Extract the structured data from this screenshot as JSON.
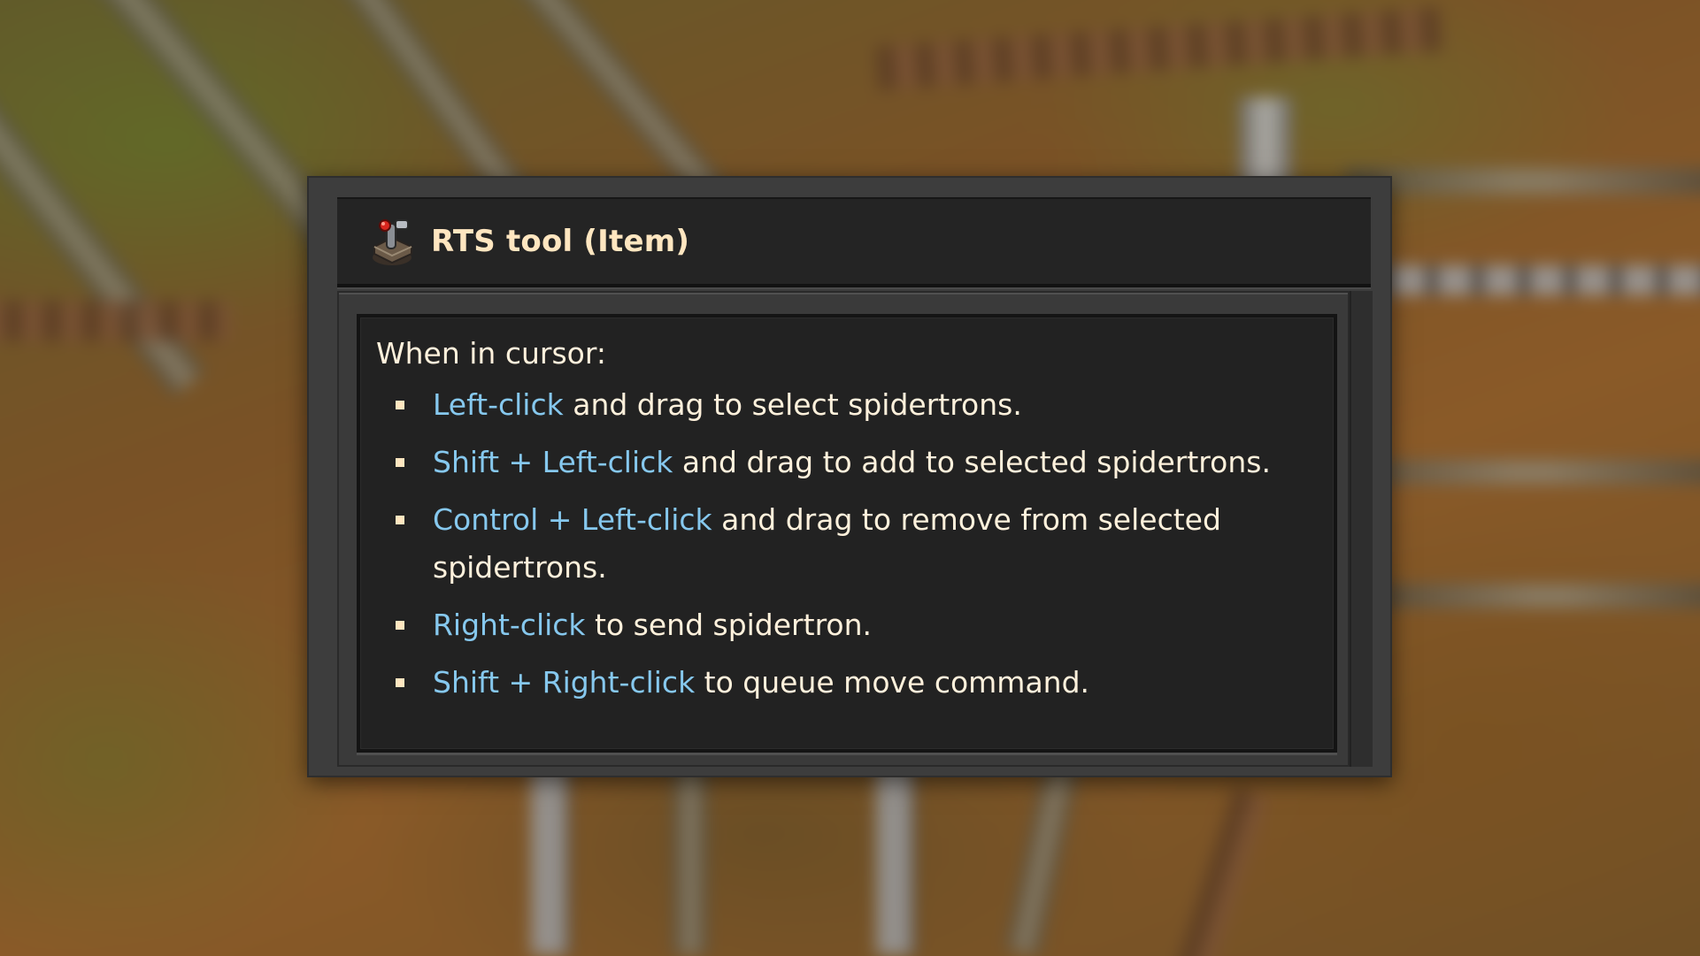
{
  "tooltip": {
    "title": "RTS tool (Item)",
    "icon": "rts-tool-item-icon",
    "intro": "When in cursor:",
    "hints": [
      {
        "key": "Left-click",
        "text": " and drag to select spidertrons."
      },
      {
        "key": "Shift + Left-click",
        "text": " and drag to add to selected spidertrons."
      },
      {
        "key": "Control + Left-click",
        "text": " and drag to remove from selected spidertrons."
      },
      {
        "key": "Right-click",
        "text": " to send spidertron."
      },
      {
        "key": "Shift + Right-click",
        "text": " to queue move command."
      }
    ]
  },
  "colors": {
    "title": "#ffe6c0",
    "body_text": "#fff1dc",
    "key_highlight": "#86c8ee",
    "panel": "#3d3d3d",
    "panel_inner": "#222222"
  }
}
